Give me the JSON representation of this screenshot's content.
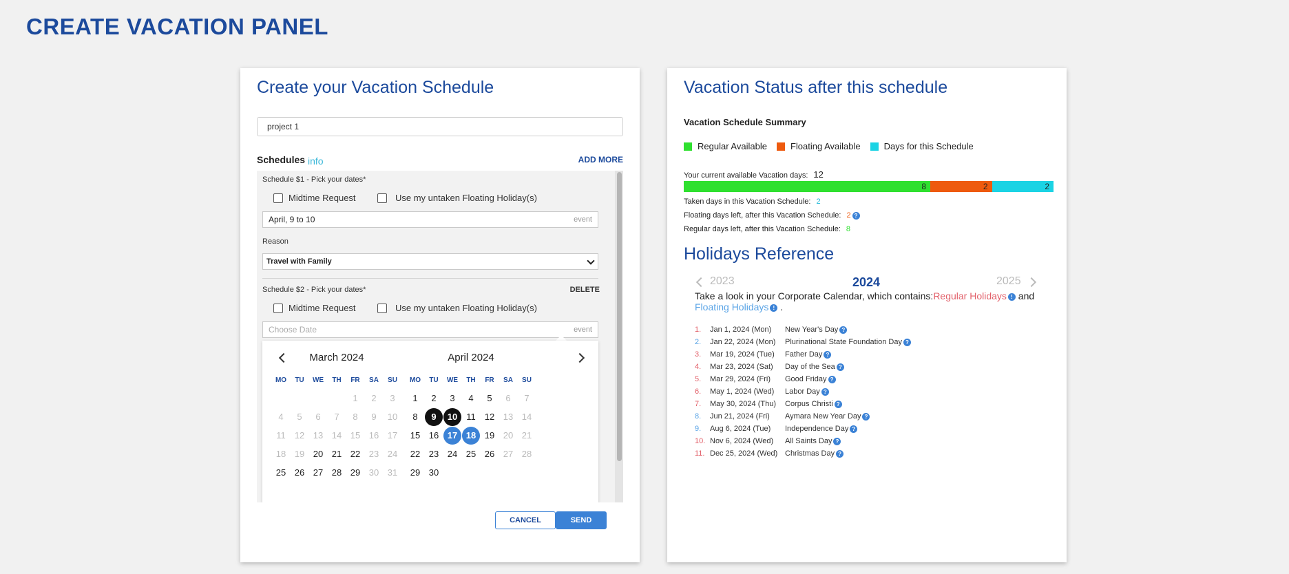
{
  "page": {
    "title": "CREATE VACATION PANEL"
  },
  "left": {
    "title": "Create your Vacation Schedule",
    "project_value": "project 1",
    "schedules_label": "Schedules",
    "info_label": "info",
    "add_more_label": "ADD MORE",
    "schedule1": {
      "label": "Schedule $1 - Pick your dates",
      "required": "*",
      "midtime_label": "Midtime Request",
      "floating_label": "Use my untaken Floating Holiday(s)",
      "date_value": "April, 9 to 10",
      "event_label": "event",
      "reason_label": "Reason",
      "reason_value": "Travel with Family"
    },
    "schedule2": {
      "label": "Schedule $2 - Pick your dates",
      "required": "*",
      "delete_label": "DELETE",
      "midtime_label": "Midtime Request",
      "floating_label": "Use my untaken Floating Holiday(s)",
      "date_placeholder": "Choose Date",
      "event_label": "event"
    },
    "calendar": {
      "dow": [
        "MO",
        "TU",
        "WE",
        "TH",
        "FR",
        "SA",
        "SU"
      ],
      "months": [
        {
          "title": "March 2024",
          "weeks": [
            [
              {
                "t": ""
              },
              {
                "t": ""
              },
              {
                "t": ""
              },
              {
                "t": ""
              },
              {
                "t": "1",
                "s": "off"
              },
              {
                "t": "2",
                "s": "off"
              },
              {
                "t": "3",
                "s": "off"
              }
            ],
            [
              {
                "t": "4",
                "s": "off"
              },
              {
                "t": "5",
                "s": "off"
              },
              {
                "t": "6",
                "s": "off"
              },
              {
                "t": "7",
                "s": "off"
              },
              {
                "t": "8",
                "s": "off"
              },
              {
                "t": "9",
                "s": "off"
              },
              {
                "t": "10",
                "s": "off"
              }
            ],
            [
              {
                "t": "11",
                "s": "off"
              },
              {
                "t": "12",
                "s": "off"
              },
              {
                "t": "13",
                "s": "off"
              },
              {
                "t": "14",
                "s": "off"
              },
              {
                "t": "15",
                "s": "off"
              },
              {
                "t": "16",
                "s": "off"
              },
              {
                "t": "17",
                "s": "off"
              }
            ],
            [
              {
                "t": "18",
                "s": "off"
              },
              {
                "t": "19",
                "s": "off"
              },
              {
                "t": "20"
              },
              {
                "t": "21"
              },
              {
                "t": "22"
              },
              {
                "t": "23",
                "s": "off"
              },
              {
                "t": "24",
                "s": "off"
              }
            ],
            [
              {
                "t": "25"
              },
              {
                "t": "26"
              },
              {
                "t": "27"
              },
              {
                "t": "28"
              },
              {
                "t": "29"
              },
              {
                "t": "30",
                "s": "off"
              },
              {
                "t": "31",
                "s": "off"
              }
            ]
          ]
        },
        {
          "title": "April 2024",
          "weeks": [
            [
              {
                "t": "1"
              },
              {
                "t": "2"
              },
              {
                "t": "3"
              },
              {
                "t": "4"
              },
              {
                "t": "5"
              },
              {
                "t": "6",
                "s": "off"
              },
              {
                "t": "7",
                "s": "off"
              }
            ],
            [
              {
                "t": "8"
              },
              {
                "t": "9",
                "s": "sel-black"
              },
              {
                "t": "10",
                "s": "sel-black"
              },
              {
                "t": "11"
              },
              {
                "t": "12"
              },
              {
                "t": "13",
                "s": "off"
              },
              {
                "t": "14",
                "s": "off"
              }
            ],
            [
              {
                "t": "15"
              },
              {
                "t": "16"
              },
              {
                "t": "17",
                "s": "sel-blue"
              },
              {
                "t": "18",
                "s": "sel-blue"
              },
              {
                "t": "19"
              },
              {
                "t": "20",
                "s": "off"
              },
              {
                "t": "21",
                "s": "off"
              }
            ],
            [
              {
                "t": "22"
              },
              {
                "t": "23"
              },
              {
                "t": "24"
              },
              {
                "t": "25"
              },
              {
                "t": "26"
              },
              {
                "t": "27",
                "s": "off"
              },
              {
                "t": "28",
                "s": "off"
              }
            ],
            [
              {
                "t": "29"
              },
              {
                "t": "30"
              },
              {
                "t": ""
              },
              {
                "t": ""
              },
              {
                "t": ""
              },
              {
                "t": ""
              },
              {
                "t": ""
              }
            ]
          ]
        }
      ]
    },
    "cancel_label": "CANCEL",
    "send_label": "SEND"
  },
  "right": {
    "title": "Vacation Status after this schedule",
    "summary_title": "Vacation Schedule Summary",
    "legend": [
      {
        "label": "Regular Available",
        "color": "#2fe02f"
      },
      {
        "label": "Floating Available",
        "color": "#ee5a0e"
      },
      {
        "label": "Days for this Schedule",
        "color": "#1bd3e4"
      }
    ],
    "available_label": "Your current available Vacation days:",
    "available_value": "12",
    "bar": [
      {
        "value": 8,
        "label": "8",
        "color": "#2fe02f"
      },
      {
        "value": 2,
        "label": "2",
        "color": "#ee5a0e"
      },
      {
        "value": 2,
        "label": "2",
        "color": "#1bd3e4"
      }
    ],
    "taken_label": "Taken days in this Vacation Schedule:",
    "taken_value": "2",
    "floating_left_label": "Floating days left, after this Vacation Schedule:",
    "floating_left_value": "2",
    "regular_left_label": "Regular days left, after this Vacation Schedule:",
    "regular_left_value": "8",
    "holidays_title": "Holidays Reference",
    "year_prev": "2023",
    "year_current": "2024",
    "year_next": "2025",
    "desc_prefix": "Take a look in your Corporate Calendar, which contains:",
    "desc_regular": "Regular Holidays",
    "desc_and": " and",
    "desc_floating": "Floating Holidays",
    "desc_end": ".",
    "holidays": [
      {
        "n": "1.",
        "date": "Jan 1, 2024 (Mon)",
        "name": "New Year's Day",
        "type": "regular"
      },
      {
        "n": "2.",
        "date": "Jan 22, 2024 (Mon)",
        "name": "Plurinational State Foundation Day",
        "type": "floating"
      },
      {
        "n": "3.",
        "date": "Mar 19, 2024 (Tue)",
        "name": "Father Day",
        "type": "regular"
      },
      {
        "n": "4.",
        "date": "Mar 23, 2024 (Sat)",
        "name": "Day of the Sea",
        "type": "regular"
      },
      {
        "n": "5.",
        "date": "Mar 29, 2024 (Fri)",
        "name": "Good Friday",
        "type": "regular"
      },
      {
        "n": "6.",
        "date": "May 1, 2024 (Wed)",
        "name": "Labor Day",
        "type": "regular"
      },
      {
        "n": "7.",
        "date": "May 30, 2024 (Thu)",
        "name": "Corpus Christi",
        "type": "regular"
      },
      {
        "n": "8.",
        "date": "Jun 21, 2024 (Fri)",
        "name": "Aymara New Year Day",
        "type": "floating"
      },
      {
        "n": "9.",
        "date": "Aug 6, 2024 (Tue)",
        "name": "Independence Day",
        "type": "floating"
      },
      {
        "n": "10.",
        "date": "Nov 6, 2024 (Wed)",
        "name": "All Saints Day",
        "type": "regular"
      },
      {
        "n": "11.",
        "date": "Dec 25, 2024 (Wed)",
        "name": "Christmas Day",
        "type": "regular"
      }
    ],
    "colors": {
      "regular": "#e2606a",
      "floating": "#5aa4e6",
      "taken": "#1bb7d8",
      "regular_left": "#2fe02f",
      "floating_left": "#ee5a0e"
    }
  }
}
